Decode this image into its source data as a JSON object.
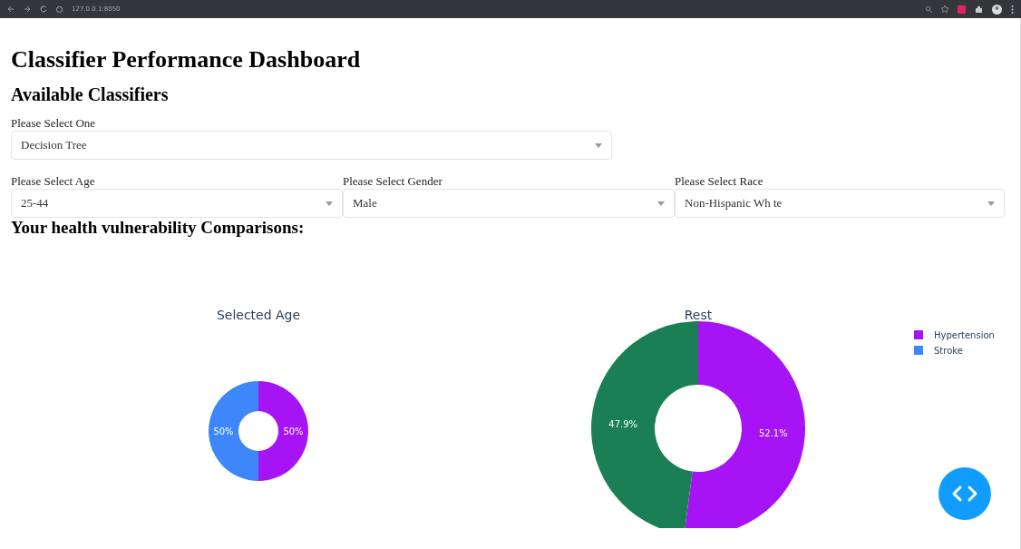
{
  "browser": {
    "url": "127.0.0.1:8050"
  },
  "title": "Classifier Performance Dashboard",
  "subtitle": "Available Classifiers",
  "classifier": {
    "label": "Please Select One",
    "value": "Decision Tree"
  },
  "filters": [
    {
      "label": "Please Select Age",
      "value": "25-44"
    },
    {
      "label": "Please Select Gender",
      "value": "Male"
    },
    {
      "label": "Please Select Race",
      "value": "Non-Hispanic Wh te"
    }
  ],
  "comparison_heading": "Your health vulnerability Comparisons:",
  "charts": [
    {
      "slices": [
        {
          "color": "#a614f5"
        },
        {
          "color": "#3d87fb"
        }
      ],
      "chart_data": {
        "type": "donut",
        "title": "Selected Age",
        "values": [
          50,
          50
        ],
        "value_labels": [
          "50%",
          "50%"
        ]
      }
    },
    {
      "slices": [
        {
          "color": "#a614f5"
        },
        {
          "color": "#1b7f55"
        }
      ],
      "chart_data": {
        "type": "donut",
        "title": "Rest",
        "values": [
          52.1,
          47.9
        ],
        "value_labels": [
          "52.1%",
          "47.9%"
        ]
      }
    }
  ],
  "legend": [
    {
      "label": "Hypertension",
      "color": "#a614f5"
    },
    {
      "label": "Stroke",
      "color": "#3d87fb"
    }
  ]
}
